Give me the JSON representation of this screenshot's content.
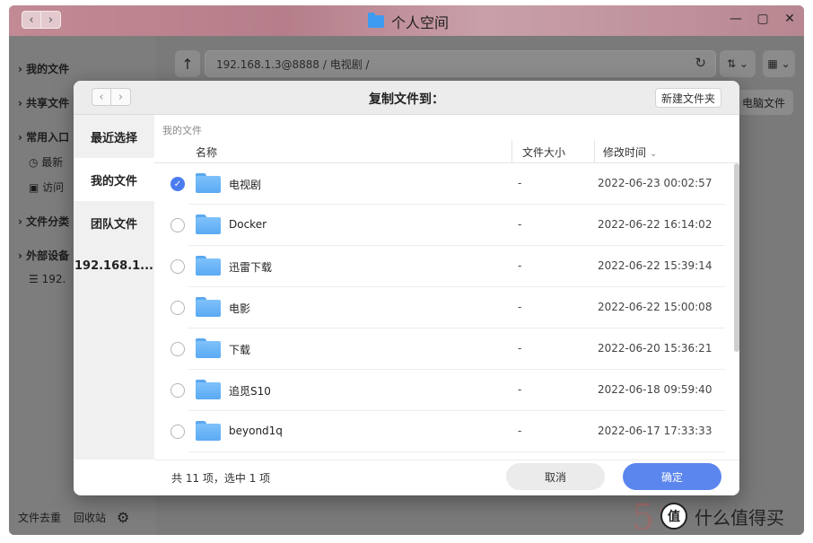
{
  "window": {
    "title": "个人空间",
    "controls": {
      "minimize": "—",
      "maximize": "▢",
      "close": "✕"
    }
  },
  "background": {
    "sidebar": {
      "items": [
        "我的文件",
        "共享文件",
        "常用入口",
        "最新",
        "访问",
        "文件分类",
        "外部设备",
        "192."
      ],
      "footer": {
        "dedupe": "文件去重",
        "recycle": "回收站"
      }
    },
    "address": "192.168.1.3@8888 / 电视剧 /",
    "pc_files_button": "电脑文件"
  },
  "dialog": {
    "title": "复制文件到：",
    "new_folder_button": "新建文件夹",
    "sidebar": [
      {
        "label": "最近选择",
        "active": false
      },
      {
        "label": "我的文件",
        "active": true
      },
      {
        "label": "团队文件",
        "active": false
      },
      {
        "label": "192.168.1...",
        "active": false
      }
    ],
    "breadcrumb": "我的文件",
    "columns": {
      "name": "名称",
      "size": "文件大小",
      "time": "修改时间"
    },
    "rows": [
      {
        "name": "电视剧",
        "size": "-",
        "time": "2022-06-23 00:02:57",
        "checked": true
      },
      {
        "name": "Docker",
        "size": "-",
        "time": "2022-06-22 16:14:02",
        "checked": false
      },
      {
        "name": "迅雷下载",
        "size": "-",
        "time": "2022-06-22 15:39:14",
        "checked": false
      },
      {
        "name": "电影",
        "size": "-",
        "time": "2022-06-22 15:00:08",
        "checked": false
      },
      {
        "name": "下载",
        "size": "-",
        "time": "2022-06-20 15:36:21",
        "checked": false
      },
      {
        "name": "追觅S10",
        "size": "-",
        "time": "2022-06-18 09:59:40",
        "checked": false
      },
      {
        "name": "beyond1q",
        "size": "-",
        "time": "2022-06-17 17:33:33",
        "checked": false
      }
    ],
    "status": "共 11 项，选中 1 项",
    "cancel_button": "取消",
    "confirm_button": "确定"
  },
  "watermark": {
    "text": "什么值得买",
    "logo": "值"
  },
  "colors": {
    "accent": "#5b86ee",
    "folder": "#5aaaf3",
    "checked": "#4a7cf0"
  }
}
